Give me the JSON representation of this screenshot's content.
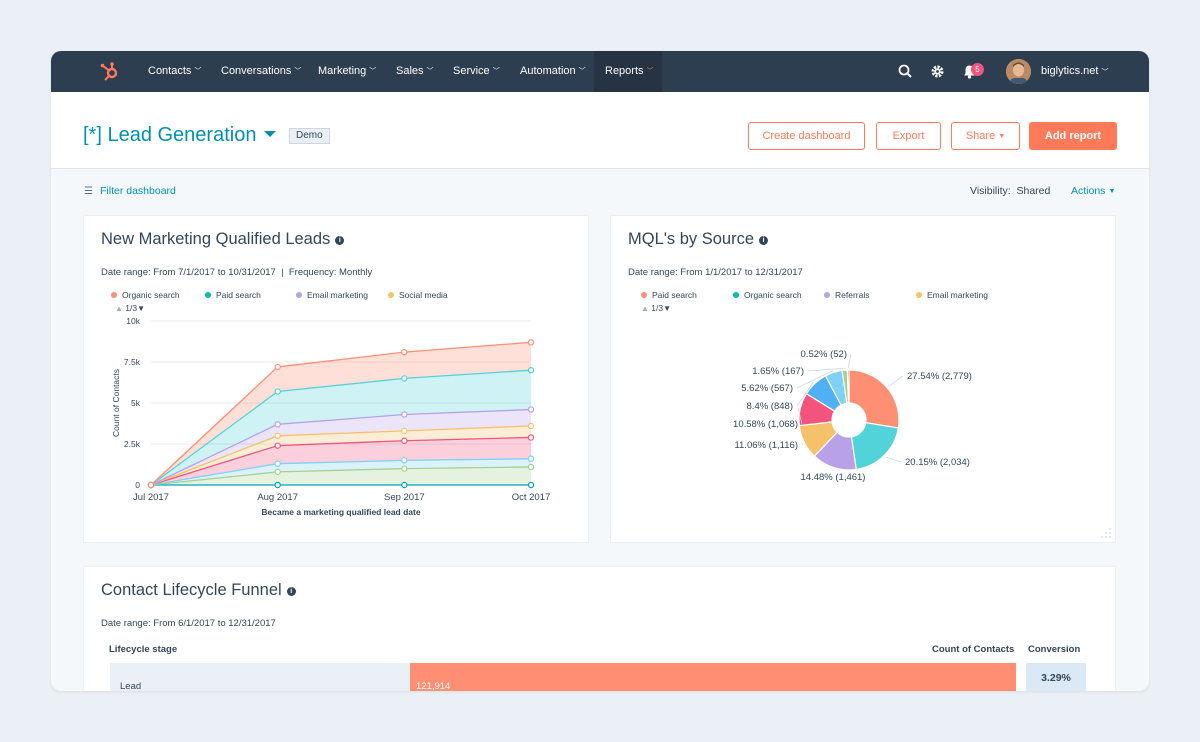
{
  "nav": {
    "items": [
      {
        "label": "Contacts"
      },
      {
        "label": "Conversations"
      },
      {
        "label": "Marketing"
      },
      {
        "label": "Sales"
      },
      {
        "label": "Service"
      },
      {
        "label": "Automation"
      },
      {
        "label": "Reports"
      }
    ],
    "active": "Reports",
    "notification_count": "5",
    "account": "biglytics.net",
    "icons": [
      "hubspot-logo-icon",
      "search-icon",
      "gear-icon",
      "bell-icon"
    ]
  },
  "header": {
    "title": "[*] Lead Generation",
    "badge": "Demo",
    "buttons": {
      "create_dashboard": "Create dashboard",
      "export": "Export",
      "share": "Share",
      "add_report": "Add report"
    }
  },
  "toolbar": {
    "filter": "Filter dashboard",
    "visibility_label": "Visibility:",
    "visibility_value": "Shared",
    "actions": "Actions"
  },
  "colors": {
    "nav_bg": "#2d3e50",
    "accent": "#ff7a59",
    "link": "#0091ae",
    "organic_search": "#ff8f73",
    "paid_search": "#00bda5",
    "email_marketing": "#b9a1e8",
    "social_media": "#f5c26b",
    "referrals": "#b9a1e8"
  },
  "cards": {
    "mql": {
      "title": "New Marketing Qualified Leads",
      "date_range": "Date range: From 7/1/2017 to 10/31/2017",
      "frequency": "Frequency: Monthly",
      "legend": [
        "Organic search",
        "Paid search",
        "Email marketing",
        "Social media"
      ],
      "pager": "1/3"
    },
    "source": {
      "title": "MQL's by Source",
      "date_range": "Date range: From 1/1/2017 to 12/31/2017",
      "legend": [
        "Paid search",
        "Organic search",
        "Referrals",
        "Email marketing"
      ],
      "pager": "1/3"
    },
    "funnel": {
      "title": "Contact Lifecycle Funnel",
      "date_range": "Date range: From 6/1/2017 to 12/31/2017",
      "col_stage": "Lifecycle stage",
      "col_count": "Count of Contacts",
      "col_conversion": "Conversion",
      "rows": [
        {
          "stage": "Lead",
          "count": "121,914",
          "conversion": "3.29%"
        }
      ]
    }
  },
  "chart_data": [
    {
      "type": "area",
      "title": "New Marketing Qualified Leads",
      "xlabel": "Became a marketing qualified lead date",
      "ylabel": "Count of Contacts",
      "categories": [
        "Jul 2017",
        "Aug 2017",
        "Sep 2017",
        "Oct 2017"
      ],
      "y_ticks": [
        "0",
        "2.5k",
        "5k",
        "7.5k",
        "10k"
      ],
      "ylim": [
        0,
        10000
      ],
      "stacked": true,
      "series": [
        {
          "name": "s-bottom",
          "values": [
            0,
            0,
            0,
            0
          ],
          "color": "#00a4bd"
        },
        {
          "name": "s-olive",
          "values": [
            0,
            800,
            1000,
            1100
          ],
          "color": "#a2d28f"
        },
        {
          "name": "s-blue",
          "values": [
            0,
            1300,
            1500,
            1600
          ],
          "color": "#7fd1f5"
        },
        {
          "name": "s-pink",
          "values": [
            0,
            2400,
            2700,
            2900
          ],
          "color": "#f2547d"
        },
        {
          "name": "s-yellow",
          "values": [
            0,
            3000,
            3300,
            3600
          ],
          "color": "#f5c26b"
        },
        {
          "name": "s-purple",
          "values": [
            0,
            3700,
            4300,
            4600
          ],
          "color": "#b9a1e8"
        },
        {
          "name": "s-teal",
          "values": [
            0,
            5700,
            6500,
            7000
          ],
          "color": "#51d3d9"
        },
        {
          "name": "s-orange",
          "values": [
            0,
            7200,
            8100,
            8700
          ],
          "color": "#ff8f73"
        }
      ],
      "grid": true
    },
    {
      "type": "pie",
      "title": "MQL's by Source",
      "donut": true,
      "slices": [
        {
          "label": "27.54% (2,779)",
          "value": 2779,
          "color": "#ff8f73"
        },
        {
          "label": "20.15% (2,034)",
          "value": 2034,
          "color": "#51d3d9"
        },
        {
          "label": "14.48% (1,461)",
          "value": 1461,
          "color": "#b9a1e8"
        },
        {
          "label": "11.06% (1,116)",
          "value": 1116,
          "color": "#f5c26b"
        },
        {
          "label": "10.58% (1,068)",
          "value": 1068,
          "color": "#f2547d"
        },
        {
          "label": "8.4% (848)",
          "value": 848,
          "color": "#4fb0f5"
        },
        {
          "label": "5.62% (567)",
          "value": 567,
          "color": "#7fd1f5"
        },
        {
          "label": "1.65% (167)",
          "value": 167,
          "color": "#a2d28f"
        },
        {
          "label": "0.52% (52)",
          "value": 52,
          "color": "#ff5c35"
        }
      ]
    }
  ]
}
